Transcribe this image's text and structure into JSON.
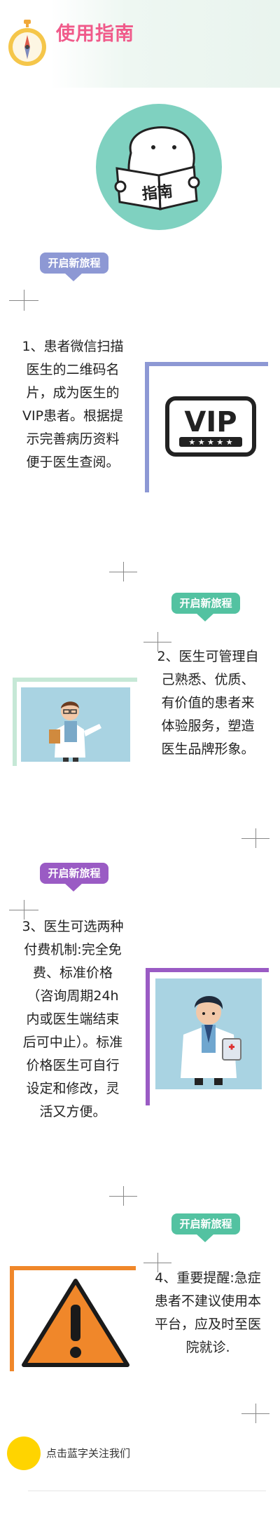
{
  "header": {
    "title": "使用指南"
  },
  "hero": {
    "book_label": "指南"
  },
  "steps": [
    {
      "tag": "开启新旅程",
      "text": "1、患者微信扫描医生的二维码名片，成为医生的VIP患者。根据提示完善病历资料便于医生查阅。",
      "image_text": "VIP",
      "color": "#8d98d4"
    },
    {
      "tag": "开启新旅程",
      "text": "2、医生可管理自己熟悉、优质、有价值的患者来体验服务，塑造医生品牌形象。",
      "color": "#53c2a1"
    },
    {
      "tag": "开启新旅程",
      "text": "3、医生可选两种付费机制:完全免费、标准价格（咨询周期24h内或医生端结束后可中止）。标准价格医生可自行设定和修改，灵活又方便。",
      "color": "#9a5bc4"
    },
    {
      "tag": "开启新旅程",
      "text": "4、重要提醒:急症患者不建议使用本平台，应及时至医院就诊.",
      "color": "#53c2a1"
    }
  ],
  "footer": {
    "follow_text": "点击蓝字关注我们"
  },
  "colors": {
    "title": "#f05a8a",
    "teal": "#53c2a1",
    "periwinkle": "#8d98d4",
    "purple": "#9a5bc4",
    "orange": "#f0872a",
    "yellow": "#ffd400"
  }
}
